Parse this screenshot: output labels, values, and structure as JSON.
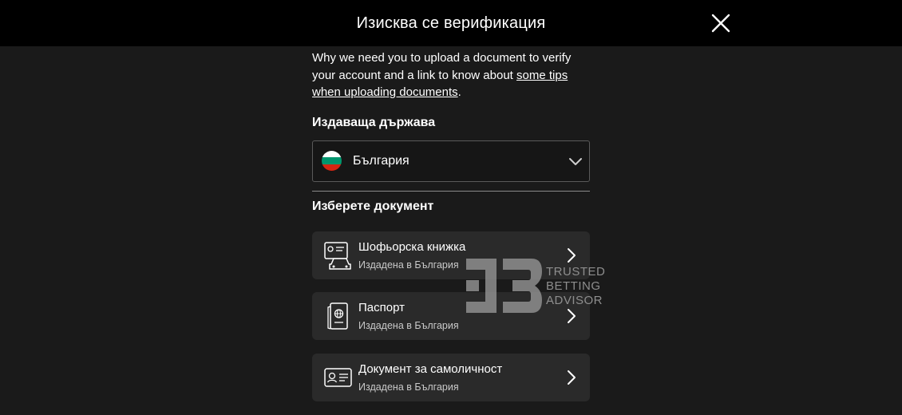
{
  "header": {
    "title": "Изисква се верификация"
  },
  "intro": {
    "text_before": "Why we need you to upload a document to verify your account and a link to know about ",
    "link_text": "some tips when uploading documents",
    "text_after": "."
  },
  "country": {
    "label": "Издаваща държава",
    "selected": "България",
    "flag_colors": [
      "#ffffff",
      "#00966e",
      "#d62612"
    ]
  },
  "documents": {
    "label": "Изберете документ",
    "items": [
      {
        "title": "Шофьорска книжка",
        "subtitle": "Издадена в България",
        "icon": "driving-license-icon"
      },
      {
        "title": "Паспорт",
        "subtitle": "Издадена в България",
        "icon": "passport-icon"
      },
      {
        "title": "Документ за самоличност",
        "subtitle": "Издадена в България",
        "icon": "id-card-icon"
      }
    ]
  },
  "watermark": {
    "line1": "TRUSTED",
    "line2": "BETTING",
    "line3": "ADVISOR"
  }
}
